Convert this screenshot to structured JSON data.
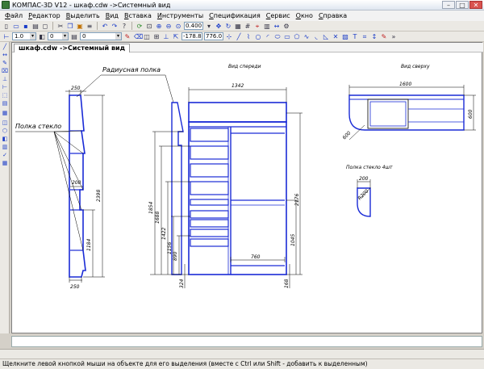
{
  "window": {
    "title": "КОМПАС-3D V12 - шкаф.cdw ->Системный вид"
  },
  "menu": [
    "Файл",
    "Редактор",
    "Выделить",
    "Вид",
    "Вставка",
    "Инструменты",
    "Спецификация",
    "Сервис",
    "Окно",
    "Справка"
  ],
  "toolbar": {
    "scale_value": "0.400",
    "line_width": "1.0",
    "layer_value": "0",
    "style_value": "0",
    "coord_x": "-178.8",
    "coord_y": "776.0"
  },
  "document": {
    "tab_label": "шкаф.cdw ->Системный вид"
  },
  "drawing": {
    "labels": {
      "radius_shelf": "Радиусная полка",
      "glass_shelf": "Полка стекло",
      "front_view": "Вид спереди",
      "top_view": "Вид сверху",
      "glass_shelf_4": "Полка стекло 4шт"
    },
    "dims": {
      "side_top_width": "250",
      "side_mid_width": "200",
      "side_bottom_width": "250",
      "side_total_height": "2398",
      "side_lower_height": "1184",
      "front_width": "1342",
      "front_1854": "1854",
      "front_1688": "1688",
      "front_1422": "1422",
      "front_1156": "1156",
      "front_890": "890",
      "front_324": "324",
      "front_2176": "2176",
      "front_1045": "1045",
      "front_168": "168",
      "front_rail": "760",
      "top_width": "1600",
      "top_depth": "600",
      "top_radius": "600",
      "glass_width": "200",
      "glass_radius": "R200"
    }
  },
  "status": {
    "hint": "Щелкните левой кнопкой мыши на объекте для его выделения (вместе с Ctrl или Shift - добавить к выделенным)"
  }
}
